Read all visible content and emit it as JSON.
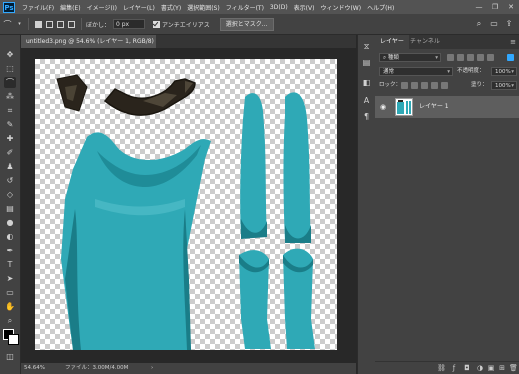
{
  "app": {
    "logo": "Ps"
  },
  "menu": {
    "items": [
      "ファイル(F)",
      "編集(E)",
      "イメージ(I)",
      "レイヤー(L)",
      "書式(Y)",
      "選択範囲(S)",
      "フィルター(T)",
      "3D(D)",
      "表示(V)",
      "ウィンドウ(W)",
      "ヘルプ(H)"
    ],
    "window_controls": [
      "—",
      "❐",
      "✕"
    ]
  },
  "options_bar": {
    "feather_label": "ぼかし：",
    "feather_value": "0 px",
    "antialias_label": "アンチエイリアス",
    "antialias_checked": true,
    "select_mask_label": "選択とマスク...",
    "right_icons": [
      "search-icon",
      "workspace-icon",
      "share-icon"
    ]
  },
  "document": {
    "tab_title": "untitled3.png @ 54.6% (レイヤー 1, RGB/8) *",
    "close": "×"
  },
  "status_bar": {
    "zoom": "54.64%",
    "file_info": "ファイル：3.00M/4.00M",
    "arrow": "›"
  },
  "colors": {
    "foreground": "#000000",
    "background": "#ffffff",
    "garment": "#2fa9b6",
    "collar": "#2a241c"
  },
  "layers_panel": {
    "tabs": [
      "レイヤー",
      "チャンネル"
    ],
    "filter_label": "種類",
    "blend_mode": "通常",
    "opacity_label": "不透明度：",
    "opacity_value": "100%",
    "lock_label": "ロック：",
    "fill_label": "塗り：",
    "fill_value": "100%",
    "layers": [
      {
        "name": "レイヤー 1",
        "visible": true
      }
    ]
  }
}
